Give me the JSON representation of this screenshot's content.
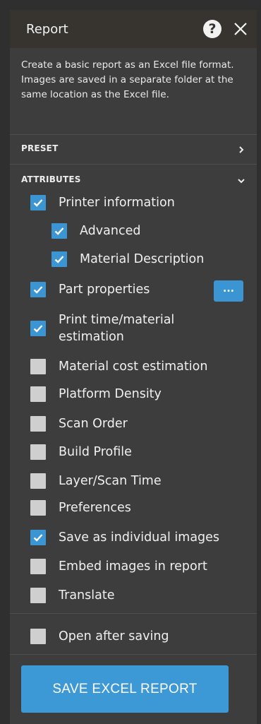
{
  "header": {
    "title": "Report"
  },
  "description": "Create a basic report as an Excel file format. Images are saved in a separate folder at the same location as the  Excel file.",
  "sections": {
    "preset": "PRESET",
    "attributes": "ATTRIBUTES"
  },
  "options": [
    {
      "label": "Printer information",
      "checked": true
    },
    {
      "label": "Advanced",
      "checked": true
    },
    {
      "label": "Material Description",
      "checked": true
    },
    {
      "label": "Part properties",
      "checked": true
    },
    {
      "label": "Print time/material estimation",
      "checked": true
    },
    {
      "label": "Material cost estimation",
      "checked": false
    },
    {
      "label": "Platform Density",
      "checked": false
    },
    {
      "label": "Scan Order",
      "checked": false
    },
    {
      "label": "Build Profile",
      "checked": false
    },
    {
      "label": "Layer/Scan Time",
      "checked": false
    },
    {
      "label": "Preferences",
      "checked": false
    },
    {
      "label": "Save as individual images",
      "checked": true
    },
    {
      "label": "Embed images in report",
      "checked": false
    },
    {
      "label": "Translate",
      "checked": false
    }
  ],
  "open_after_saving": {
    "label": "Open after saving",
    "checked": false
  },
  "part_properties_button": "...",
  "save_button": "SAVE EXCEL REPORT",
  "colors": {
    "accent": "#3c95d3",
    "panel": "#3d3d3d",
    "header": "#373430",
    "unchecked": "#cfcfcf"
  },
  "icons": {
    "help": "question-circle-icon",
    "close": "close-icon",
    "preset": "chevron-right-icon",
    "attributes": "chevron-down-icon",
    "checkbox": "checkmark-icon"
  }
}
